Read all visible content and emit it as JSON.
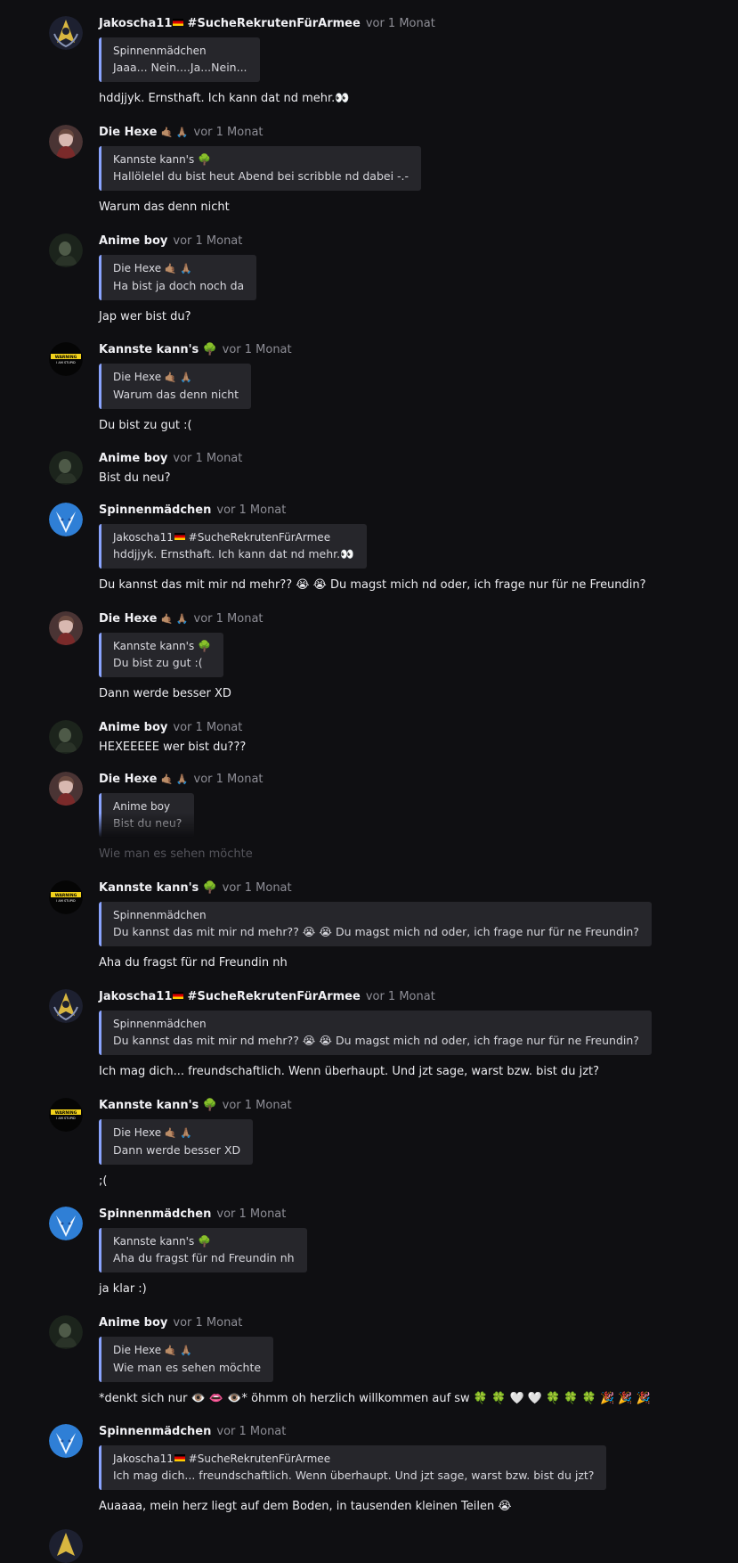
{
  "time_label": "vor 1 Monat",
  "messages": [
    {
      "author": "Jakoscha11",
      "author_suffix": "#SucheRekrutenFürArmee",
      "avatar": "avatar-gold-emblem",
      "quote": {
        "author": "Spinnenmädchen",
        "text": "Jaaa... Nein....Ja...Nein..."
      },
      "text": "hddjjyk. Ernsthaft. Ich kann dat nd mehr.👀"
    },
    {
      "author": "Die Hexe",
      "author_emoji": "🤙🏽 🙏🏽",
      "avatar": "avatar-portrait-woman",
      "quote": {
        "author": "Kannste kann's",
        "text": "Hallölelel du bist heut Abend bei scribble nd dabei -.-"
      },
      "text": "Warum das denn nicht"
    },
    {
      "author": "Anime boy",
      "avatar": "avatar-dark-character",
      "quote": {
        "author": "Die Hexe",
        "text": "Ha bist ja doch noch da"
      },
      "text": "Jap wer bist du?"
    },
    {
      "author": "Kannste kann's",
      "avatar": "avatar-warning-sign",
      "quote": {
        "author": "Die Hexe",
        "text": "Warum das denn nicht"
      },
      "text": "Du bist zu gut :("
    },
    {
      "author": "Anime boy",
      "avatar": "avatar-dark-character",
      "text": "Bist du neu?"
    },
    {
      "author": "Spinnenmädchen",
      "avatar": "avatar-white-wolf",
      "quote": {
        "author": "Jakoscha11",
        "author_suffix": "#SucheRekrutenFürArmee",
        "text": "hddjjyk. Ernsthaft. Ich kann dat nd mehr.👀"
      },
      "text": "Du kannst das mit mir nd mehr?? 😭 😭 Du magst mich nd oder, ich frage nur für ne Freundin?"
    },
    {
      "author": "Die Hexe",
      "author_emoji": "🤙🏽 🙏🏽",
      "avatar": "avatar-portrait-woman",
      "quote": {
        "author": "Kannste kann's",
        "text": "Du bist zu gut :("
      },
      "text": "Dann werde besser XD"
    },
    {
      "author": "Anime boy",
      "avatar": "avatar-dark-character",
      "text": "HEXEEEEE wer bist du???"
    },
    {
      "author": "Die Hexe",
      "author_emoji": "🤙🏽 🙏🏽",
      "avatar": "avatar-portrait-woman",
      "quote": {
        "author": "Anime boy",
        "text": "Bist du neu?"
      },
      "text": "Wie man es sehen möchte"
    },
    {
      "author": "Kannste kann's",
      "avatar": "avatar-warning-sign",
      "quote": {
        "author": "Spinnenmädchen",
        "text": "Du kannst das mit mir nd mehr?? 😭 😭 Du magst mich nd oder, ich frage nur für ne Freundin?"
      },
      "text": "Aha du fragst für nd Freundin nh"
    },
    {
      "author": "Jakoscha11",
      "author_suffix": "#SucheRekrutenFürArmee",
      "avatar": "avatar-gold-emblem",
      "quote": {
        "author": "Spinnenmädchen",
        "text": "Du kannst das mit mir nd mehr?? 😭 😭 Du magst mich nd oder, ich frage nur für ne Freundin?"
      },
      "text": "Ich mag dich... freundschaftlich. Wenn überhaupt. Und jzt sage, warst bzw. bist du jzt?"
    },
    {
      "author": "Kannste kann's",
      "avatar": "avatar-warning-sign",
      "quote": {
        "author": "Die Hexe",
        "text": "Dann werde besser XD"
      },
      "text": ";("
    },
    {
      "author": "Spinnenmädchen",
      "avatar": "avatar-white-wolf",
      "quote": {
        "author": "Kannste kann's",
        "text": "Aha du fragst für nd Freundin nh"
      },
      "text": "ja klar :)"
    },
    {
      "author": "Anime boy",
      "avatar": "avatar-dark-character",
      "quote": {
        "author": "Die Hexe",
        "text": "Wie man es sehen möchte"
      },
      "text": "*denkt sich nur 👁️ 👄 👁️* öhmm oh herzlich willkommen auf sw 🍀 🍀 🤍 🤍 🍀 🍀 🍀 🎉 🎉 🎉"
    },
    {
      "author": "Spinnenmädchen",
      "avatar": "avatar-white-wolf",
      "quote": {
        "author": "Jakoscha11",
        "author_suffix": "#SucheRekrutenFürArmee",
        "text": "Ich mag dich... freundschaftlich. Wenn überhaupt. Und jzt sage, warst bzw. bist du jzt?"
      },
      "text": "Auaaaa, mein herz liegt auf dem Boden, in tausenden kleinen Teilen 😭"
    }
  ],
  "avatar_warning": {
    "line1": "WARNING",
    "line2": "I AM STUPID"
  },
  "colors": {
    "background": "#0f0f12",
    "quote_bg": "#26262b",
    "quote_accent": "#8aa4ff",
    "time": "#8e8e96"
  }
}
